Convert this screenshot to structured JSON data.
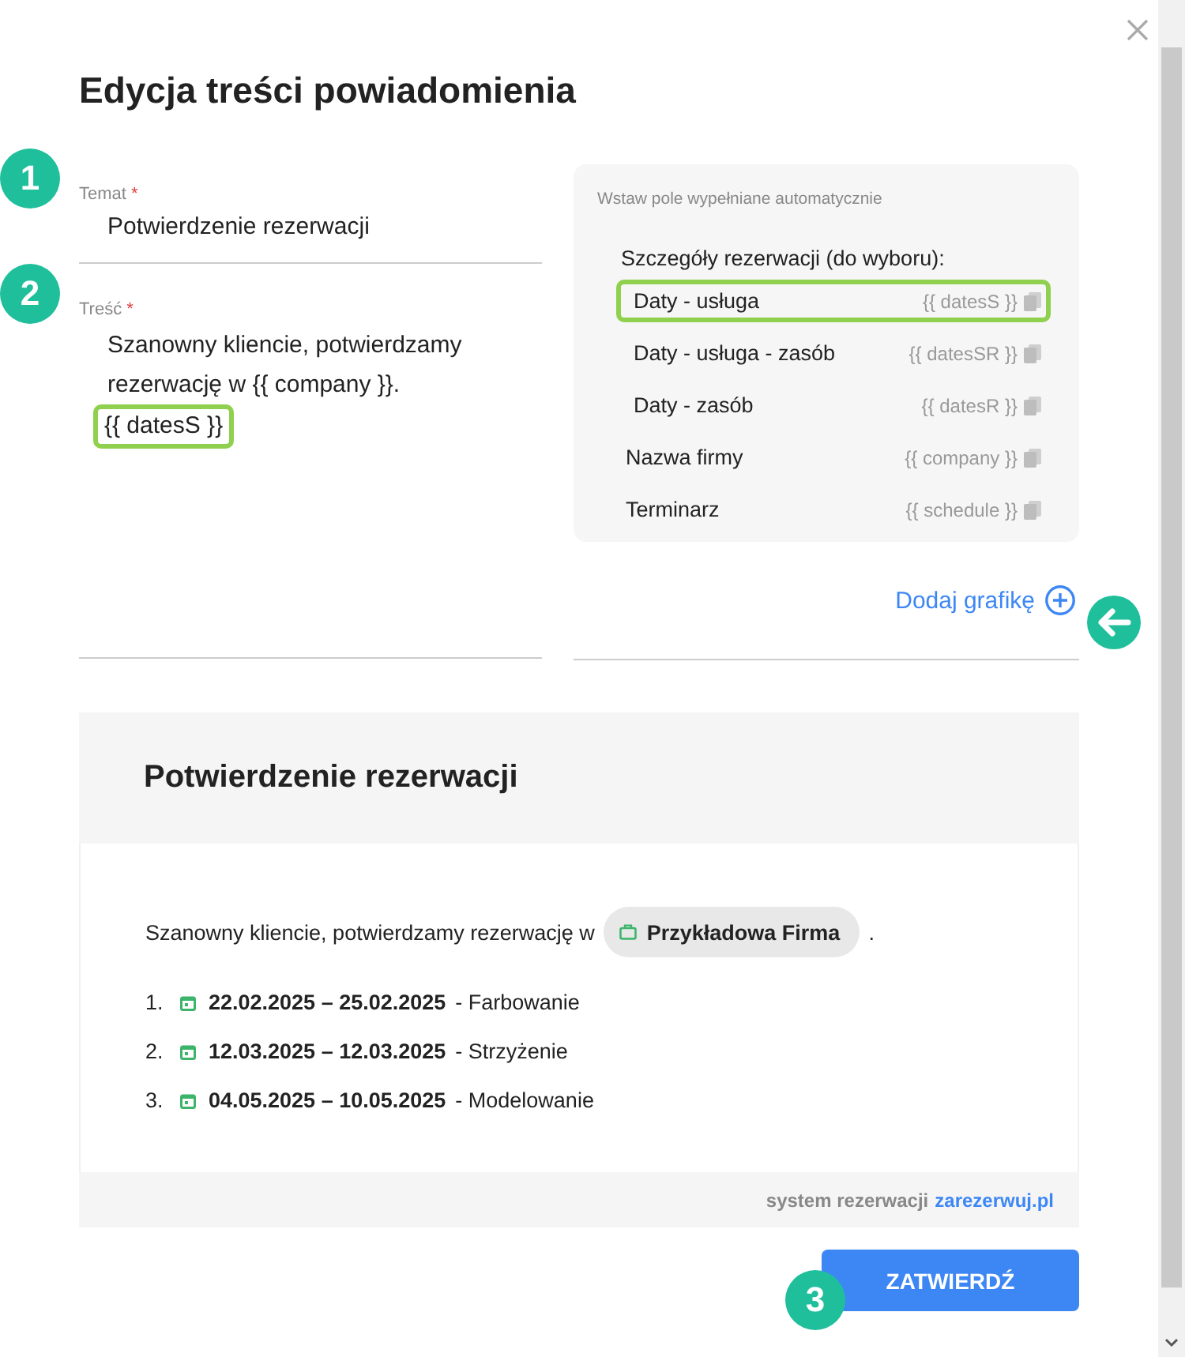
{
  "title": "Edycja treści powiadomienia",
  "subject": {
    "step": "1",
    "label": "Temat",
    "required_mark": "*",
    "value": "Potwierdzenie rezerwacji"
  },
  "body": {
    "step": "2",
    "label": "Treść",
    "required_mark": "*",
    "text": "Szanowny kliencie, potwierdzamy rezerwację w {{ company }}.",
    "token": "{{ datesS }}",
    "token_highlighted": true
  },
  "autofill": {
    "title": "Wstaw pole wypełniane automatycznie",
    "group_label": "Szczegóły rezerwacji (do wyboru):",
    "fields": [
      {
        "label": "Daty - usługa",
        "token": "{{ datesS }}",
        "indented": true,
        "highlighted": true
      },
      {
        "label": "Daty - usługa - zasób",
        "token": "{{ datesSR }}",
        "indented": true,
        "highlighted": false
      },
      {
        "label": "Daty - zasób",
        "token": "{{ datesR }}",
        "indented": true,
        "highlighted": false
      },
      {
        "label": "Nazwa firmy",
        "token": "{{ company }}",
        "indented": false,
        "highlighted": false
      },
      {
        "label": "Terminarz",
        "token": "{{ schedule }}",
        "indented": false,
        "highlighted": false
      }
    ]
  },
  "add_image": {
    "label": "Dodaj grafikę"
  },
  "preview": {
    "heading": "Potwierdzenie rezerwacji",
    "greeting": "Szanowny kliencie, potwierdzamy rezerwację w",
    "company": "Przykładowa Firma",
    "greeting_end": ".",
    "items": [
      {
        "number": "1.",
        "dates": "22.02.2025 – 25.02.2025",
        "service": "- Farbowanie"
      },
      {
        "number": "2.",
        "dates": "12.03.2025 – 12.03.2025",
        "service": "- Strzyżenie"
      },
      {
        "number": "3.",
        "dates": "04.05.2025 – 10.05.2025",
        "service": "- Modelowanie"
      }
    ],
    "footer_text": "system rezerwacji",
    "footer_link": "zarezerwuj.pl"
  },
  "confirm": {
    "step": "3",
    "label": "ZATWIERDŹ"
  }
}
